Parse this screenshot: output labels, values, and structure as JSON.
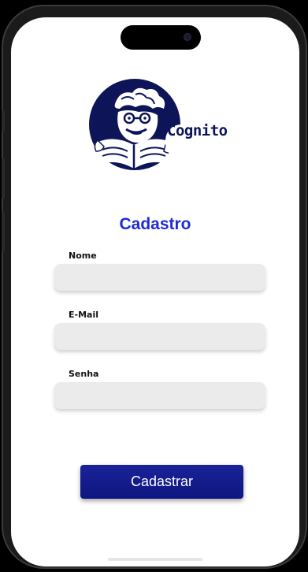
{
  "app": {
    "brand_name": "Cognito",
    "logo_icon": "reading-mascot-icon"
  },
  "form": {
    "title": "Cadastro",
    "fields": [
      {
        "label": "Nome",
        "value": "",
        "placeholder": ""
      },
      {
        "label": "E-Mail",
        "value": "",
        "placeholder": ""
      },
      {
        "label": "Senha",
        "value": "",
        "placeholder": ""
      }
    ],
    "submit_label": "Cadastrar"
  },
  "colors": {
    "brand_navy": "#0d1457",
    "title_blue": "#1f2bd6",
    "button_blue": "#141c8f",
    "input_gray": "#ebebeb"
  }
}
